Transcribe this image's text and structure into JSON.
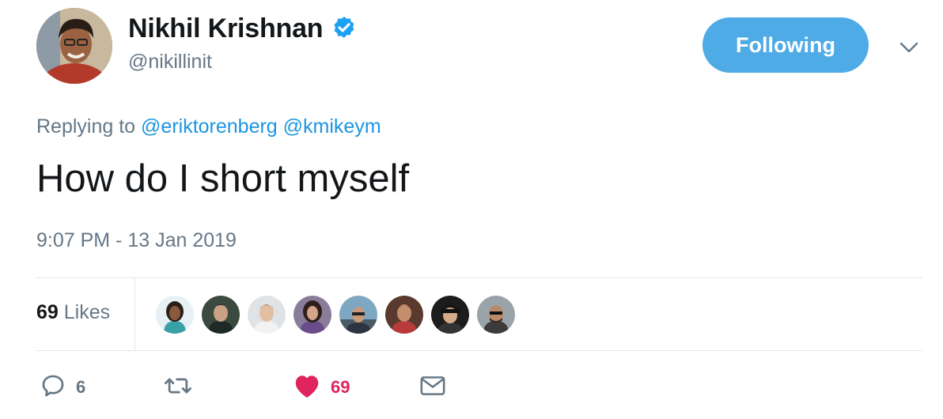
{
  "author": {
    "display_name": "Nikhil Krishnan",
    "username": "@nikillinit",
    "verified_icon": "verified-badge-icon",
    "follow_label": "Following"
  },
  "reply_context": {
    "prefix": "Replying to",
    "mentions": [
      "@eriktorenberg",
      "@kmikeym"
    ]
  },
  "tweet": {
    "text": "How do I short myself",
    "timestamp": "9:07 PM - 13 Jan 2019"
  },
  "stats": {
    "likes_count": "69",
    "likes_label": "Likes",
    "liker_avatar_count": 8
  },
  "actions": {
    "reply_count": "6",
    "retweet_count": "",
    "like_count": "69",
    "like_active": true
  },
  "colors": {
    "accent": "#1b95e0",
    "follow_button": "#4fabe6",
    "like": "#e0245e",
    "muted": "#657786",
    "divider": "#e1e8ed"
  }
}
